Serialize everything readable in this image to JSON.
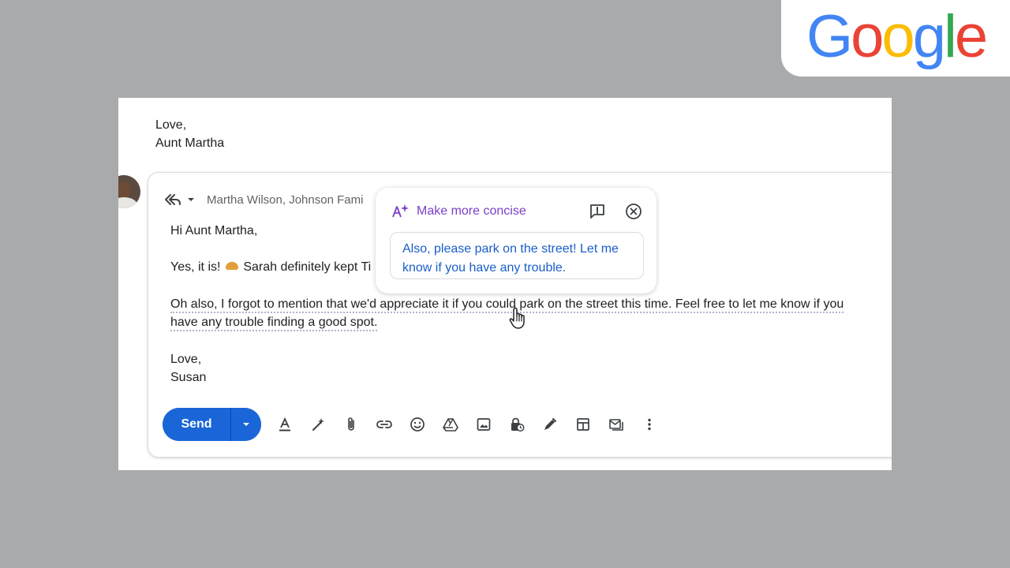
{
  "brand": {
    "logo_letters": [
      {
        "char": "G",
        "color": "#4285F4"
      },
      {
        "char": "o",
        "color": "#EA4335"
      },
      {
        "char": "o",
        "color": "#FBBC05"
      },
      {
        "char": "g",
        "color": "#4285F4"
      },
      {
        "char": "l",
        "color": "#34A853"
      },
      {
        "char": "e",
        "color": "#EA4335"
      }
    ]
  },
  "previous_message": {
    "closing": "Love,",
    "signature": "Aunt Martha"
  },
  "compose": {
    "recipients": "Martha Wilson, Johnson Fami",
    "greeting": "Hi Aunt Martha,",
    "line1_before": "Yes, it is!",
    "line1_after": "Sarah definitely kept Ti",
    "para2_line1": "Oh also, I forgot to mention that we'd appreciate it if you could park on the street this time. Feel free to let me know if you",
    "para2_line2": "have any trouble finding a good spot.",
    "closing": "Love,",
    "signature": "Susan",
    "send_label": "Send"
  },
  "toolbar_icons": [
    "format-text-icon",
    "help-me-write-icon",
    "attach-icon",
    "link-icon",
    "emoji-icon",
    "drive-icon",
    "image-icon",
    "confidential-mode-icon",
    "signature-icon",
    "layouts-icon",
    "template-icon",
    "more-options-icon"
  ],
  "ai_popup": {
    "title": "Make more concise",
    "suggestion": "Also, please park on the street! Let me know if you have any trouble."
  },
  "colors": {
    "accent_blue": "#1a66d8",
    "ai_purple": "#7b3fc8",
    "suggestion_blue": "#1a5ec8",
    "background_gray": "#a9aaac"
  }
}
